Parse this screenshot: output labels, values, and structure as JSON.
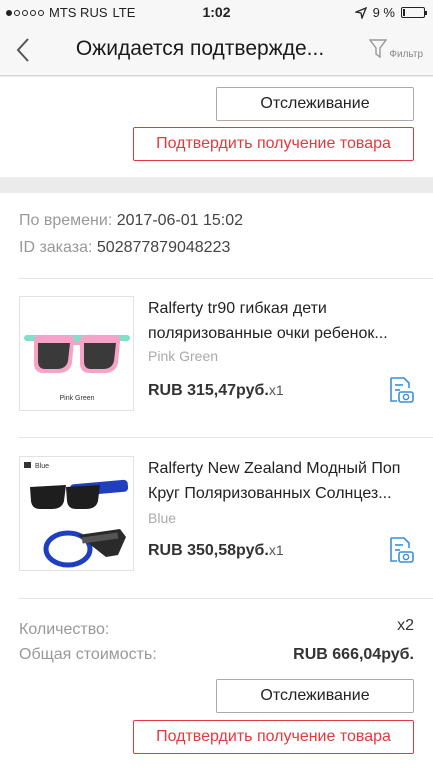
{
  "status_bar": {
    "carrier": "MTS RUS",
    "network": "LTE",
    "time": "1:02",
    "battery_text": "9 %",
    "battery_level": 0.09
  },
  "nav": {
    "title": "Ожидается подтвержде...",
    "filter_label": "Фильтр"
  },
  "top_actions": {
    "track_label": "Отслеживание",
    "confirm_label": "Подтвердить получение товара"
  },
  "order": {
    "time_label": "По времени:",
    "time_value": "2017-06-01 15:02",
    "id_label": "ID заказа:",
    "id_value": "502877879048223"
  },
  "items": [
    {
      "title_line1": "Ralferty tr90 гибкая дети",
      "title_line2": "поляризованные очки ребенок...",
      "variant": "Pink Green",
      "image_caption": "Pink Green",
      "price": "RUB 315,47руб.",
      "qty": "x1"
    },
    {
      "title_line1": "Ralferty New Zealand Модный Поп",
      "title_line2": "Круг Поляризованных Солнцез...",
      "variant": "Blue",
      "image_caption": "Blue",
      "price": "RUB 350,58руб.",
      "qty": "x1"
    }
  ],
  "summary": {
    "quantity_label": "Количество:",
    "quantity_value": "x2",
    "total_label": "Общая стоимость:",
    "total_value": "RUB 666,04руб."
  },
  "bottom_actions": {
    "track_label": "Отслеживание",
    "confirm_label": "Подтвердить получение товара"
  }
}
